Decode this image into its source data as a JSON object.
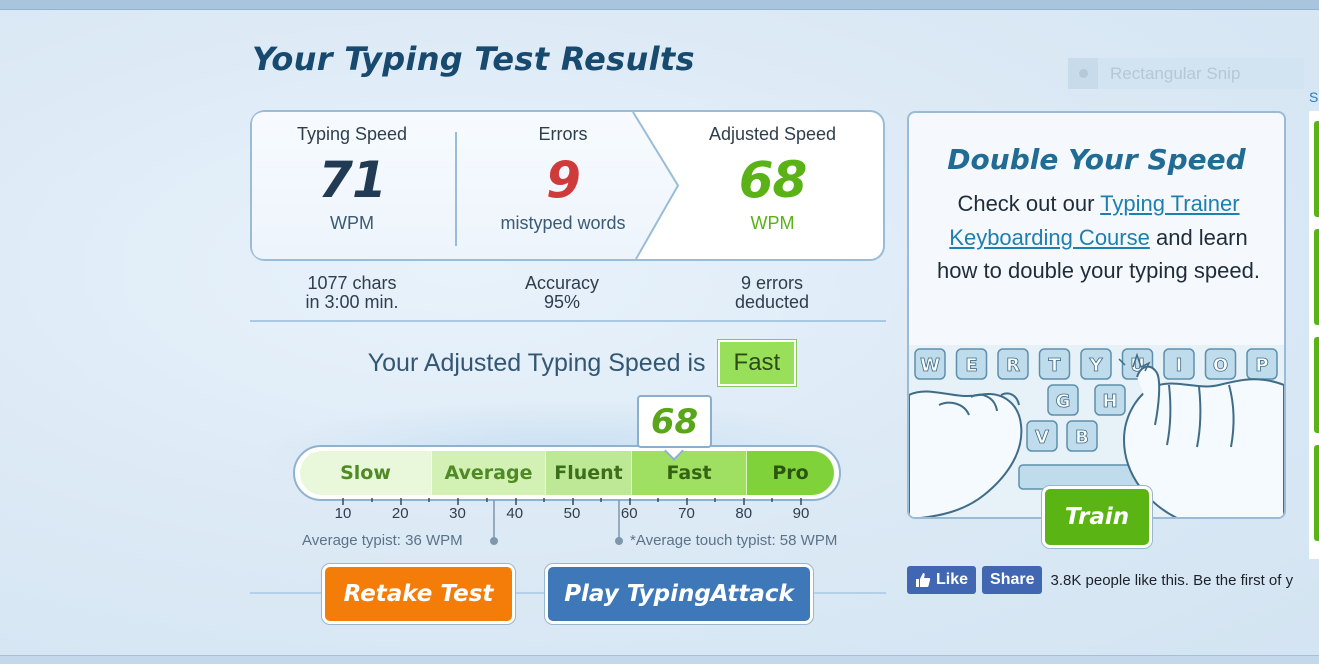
{
  "page_title": "Your Typing Test Results",
  "results": {
    "speed": {
      "label": "Typing Speed",
      "value": "71",
      "unit": "WPM"
    },
    "errors": {
      "label": "Errors",
      "value": "9",
      "unit": "mistyped words"
    },
    "adjusted": {
      "label": "Adjusted Speed",
      "value": "68",
      "unit": "WPM"
    }
  },
  "details": {
    "chars_line1": "1077 chars",
    "chars_line2": "in 3:00 min.",
    "accuracy_line1": "Accuracy",
    "accuracy_line2": "95%",
    "deducted_line1": "9 errors",
    "deducted_line2": "deducted"
  },
  "rating": {
    "prefix": "Your Adjusted Typing Speed is",
    "level": "Fast"
  },
  "scale": {
    "segments": [
      "Slow",
      "Average",
      "Fluent",
      "Fast",
      "Pro"
    ],
    "ticks": [
      "10",
      "20",
      "30",
      "40",
      "50",
      "60",
      "70",
      "80",
      "90"
    ],
    "marker_value": "68",
    "avg_note": "Average typist: 36 WPM",
    "touch_note": "*Average touch typist: 58 WPM"
  },
  "buttons": {
    "retake": "Retake Test",
    "play": "Play TypingAttack",
    "train": "Train"
  },
  "promo": {
    "title": "Double Your Speed",
    "text_before": "Check out our ",
    "link1": "Typing Trainer",
    "link2": "Keyboarding Course",
    "text_after": " and learn how to double your typing speed.",
    "keys_row1": [
      "W",
      "E",
      "R",
      "T",
      "Y",
      "U",
      "I",
      "O",
      "P"
    ],
    "keys_row2": [
      "G",
      "H"
    ],
    "keys_row3": [
      "V",
      "B"
    ]
  },
  "snip_overlay": "Rectangular Snip",
  "edge_letter": "S",
  "social": {
    "like": "Like",
    "share": "Share",
    "text": "3.8K people like this. Be the first of y"
  },
  "colors": {
    "title": "#174a6e",
    "error_red": "#cf3b3b",
    "adjusted_green": "#5ab216",
    "retake_orange": "#f47d0a",
    "play_blue": "#3e78b8",
    "train_green": "#5ab414",
    "facebook_blue": "#4267b2"
  }
}
